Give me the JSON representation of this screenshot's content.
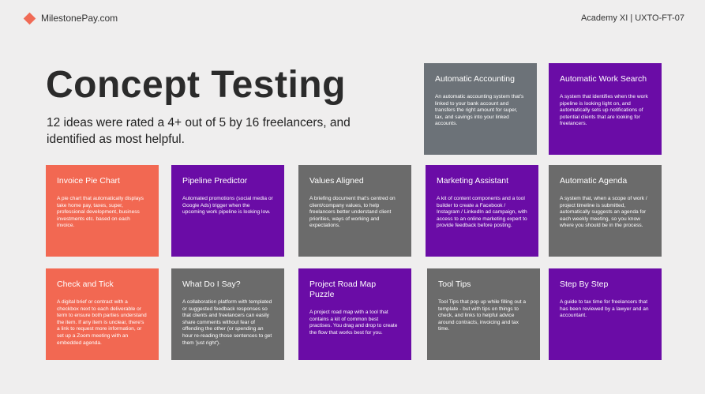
{
  "header": {
    "brand": "MilestonePay.com",
    "course": "Academy XI | UXTO-FT-07",
    "brand_color": "#f06a55"
  },
  "title": "Concept Testing",
  "subtitle": "12 ideas were rated a 4+ out of 5 by 16 freelancers, and identified as most helpful.",
  "colors": {
    "orange": "#f26852",
    "purple": "#6a0ca6",
    "gray": "#6b6b6b",
    "slate": "#6c7278",
    "background": "#efeeee"
  },
  "cards": [
    {
      "title": "Automatic Accounting",
      "description": "An automatic accounting system that's linked to your bank account and transfers the right amount for super, tax, and savings into your linked accounts.",
      "color": "slate"
    },
    {
      "title": "Automatic Work Search",
      "description": "A system that identifies when the work pipeline is looking light on, and automatically sets up notifications of potential clients that are looking for freelancers.",
      "color": "purple"
    },
    {
      "title": "Invoice Pie Chart",
      "description": "A pie chart that automatically displays take home pay, taxes, super, professional development, business investments etc. based on each invoice.",
      "color": "orange"
    },
    {
      "title": "Pipeline Predictor",
      "description": "Automated promotions (social media or Google Ads) trigger when the upcoming work pipeline is looking low.",
      "color": "purple"
    },
    {
      "title": "Values Aligned",
      "description": "A briefing document that's centred on client/company values, to help freelancers better understand client priorities, ways of working and expectations.",
      "color": "gray"
    },
    {
      "title": "Marketing Assistant",
      "description": "A kit of content components and a tool builder to create a Facebook / Instagram / LinkedIn ad campaign, with access to an online marketing expert to provide feedback before posting.",
      "color": "purple"
    },
    {
      "title": "Automatic Agenda",
      "description": "A system that, when a scope of work / project timeline is submitted, automatically suggests an agenda for each weekly meeting, so you know where you should be in the process.",
      "color": "gray"
    },
    {
      "title": "Check and Tick",
      "description": "A digital brief or contract with a checkbox next to each deliverable or term to ensure both parties understand the item. If any item is unclear, there's a link to request more information, or set up a Zoom meeting with an embedded agenda.",
      "color": "orange"
    },
    {
      "title": "What Do I Say?",
      "description": "A collaboration platform with templated or suggested feedback responses so that clients and freelancers can easily share comments without fear of offending the other (or spending an hour re-reading those sentences to get them 'just right').",
      "color": "gray"
    },
    {
      "title": "Project Road Map Puzzle",
      "description": "A project road map with a tool that contains a kit of common best practises. You drag and drop to create the flow that works best for you.",
      "color": "purple"
    },
    {
      "title": "Tool Tips",
      "description": "Tool Tips that pop up while filling out a template - but with tips on things to check, and links to helpful advice around contracts, invoicing and tax time.",
      "color": "gray"
    },
    {
      "title": "Step By Step",
      "description": "A guide to tax time for freelancers that has been reviewed by a lawyer and an accountant.",
      "color": "purple"
    }
  ]
}
